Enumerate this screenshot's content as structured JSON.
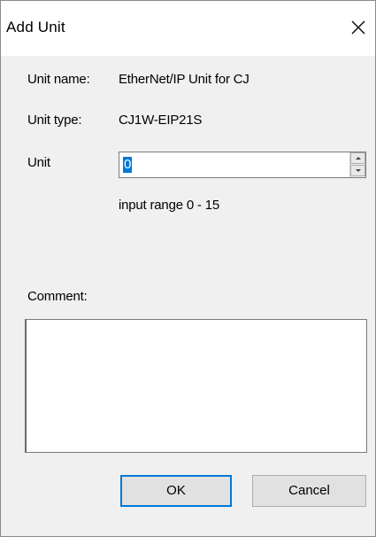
{
  "window": {
    "title": "Add Unit"
  },
  "fields": {
    "unit_name_label": "Unit name:",
    "unit_name_value": "EtherNet/IP Unit for CJ",
    "unit_type_label": "Unit type:",
    "unit_type_value": "CJ1W-EIP21S",
    "unit_label": "Unit",
    "unit_value": "0",
    "range_hint": "input range 0 - 15",
    "comment_label": "Comment:",
    "comment_value": ""
  },
  "buttons": {
    "ok_label": "OK",
    "cancel_label": "Cancel"
  },
  "icons": {
    "close": "close-icon",
    "spin_up": "spin-up-arrow-icon",
    "spin_down": "spin-down-arrow-icon"
  },
  "colors": {
    "accent": "#0078d7",
    "dialog_bg": "#f0f0f0",
    "titlebar_bg": "#ffffff"
  }
}
